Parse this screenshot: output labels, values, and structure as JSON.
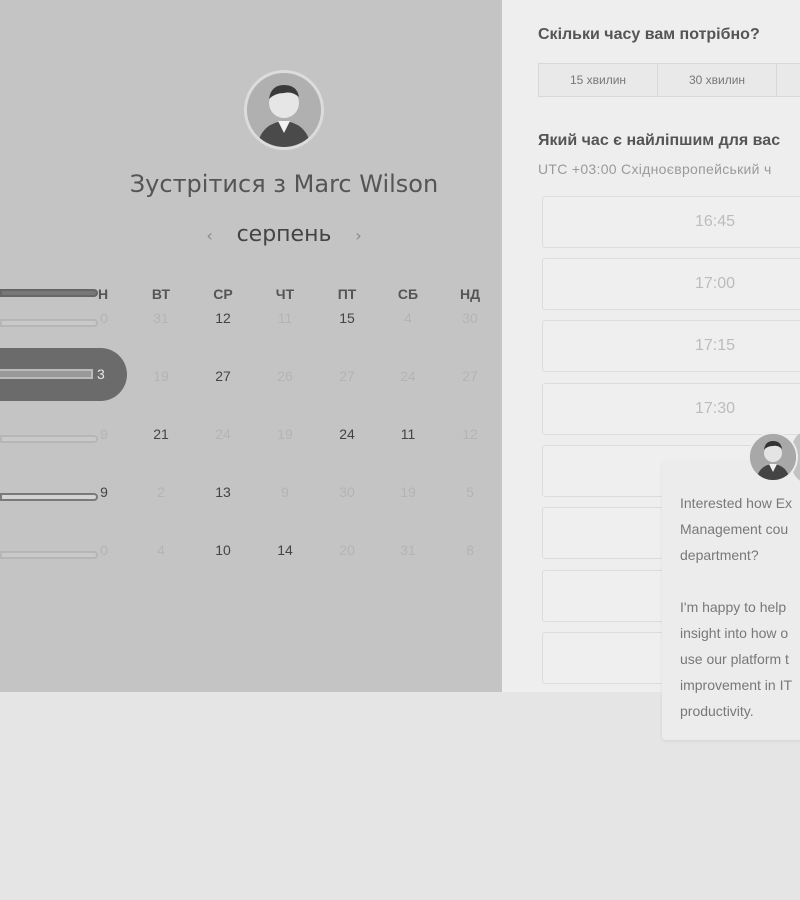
{
  "host": {
    "meet_title": "Зустрітися з Marc Wilson",
    "avatar_icon": "person-avatar-icon"
  },
  "calendar": {
    "month": "серпень",
    "prev_icon": "‹",
    "next_icon": "›",
    "weekdays_visible": [
      "ВТ",
      "СР",
      "ЧТ",
      "ПТ",
      "СБ",
      "НД"
    ],
    "monday_header_fragment": "Н",
    "rows": [
      {
        "cells": [
          {
            "t": "31",
            "on": false
          },
          {
            "t": "12",
            "on": true
          },
          {
            "t": "11",
            "on": false
          },
          {
            "t": "15",
            "on": true
          },
          {
            "t": "4",
            "on": false
          },
          {
            "t": "30",
            "on": false
          }
        ],
        "stripe_num": "0"
      },
      {
        "cells": [
          {
            "t": "19",
            "on": false
          },
          {
            "t": "27",
            "on": true
          },
          {
            "t": "26",
            "on": false
          },
          {
            "t": "27",
            "on": false
          },
          {
            "t": "24",
            "on": false
          },
          {
            "t": "27",
            "on": false
          }
        ],
        "stripe_num": "3"
      },
      {
        "cells": [
          {
            "t": "21",
            "on": true
          },
          {
            "t": "24",
            "on": false
          },
          {
            "t": "19",
            "on": false
          },
          {
            "t": "24",
            "on": true
          },
          {
            "t": "11",
            "on": true
          },
          {
            "t": "12",
            "on": false
          }
        ],
        "stripe_num": "9"
      },
      {
        "cells": [
          {
            "t": "2",
            "on": false
          },
          {
            "t": "13",
            "on": true
          },
          {
            "t": "9",
            "on": false
          },
          {
            "t": "30",
            "on": false
          },
          {
            "t": "19",
            "on": false
          },
          {
            "t": "5",
            "on": false
          }
        ],
        "stripe_num": "9"
      },
      {
        "cells": [
          {
            "t": "4",
            "on": false
          },
          {
            "t": "10",
            "on": true
          },
          {
            "t": "14",
            "on": true
          },
          {
            "t": "20",
            "on": false
          },
          {
            "t": "31",
            "on": false
          },
          {
            "t": "8",
            "on": false
          }
        ],
        "stripe_num": "0"
      }
    ]
  },
  "booking": {
    "duration_question": "Скільки часу вам потрібно?",
    "durations": [
      "15 хвилин",
      "30 хвилин",
      ""
    ],
    "time_question": "Який час є найліпшим для вас",
    "timezone": "UTC +03:00 Східноєвропейський ч",
    "slots": [
      "16:45",
      "17:00",
      "17:15",
      "17:30",
      "",
      "",
      "",
      ""
    ]
  },
  "chat": {
    "lines": [
      "Interested how Ex",
      "Management cou",
      "department?",
      "",
      "I'm happy to help",
      "insight into how o",
      "use our platform t",
      "improvement in IT",
      "productivity."
    ]
  }
}
